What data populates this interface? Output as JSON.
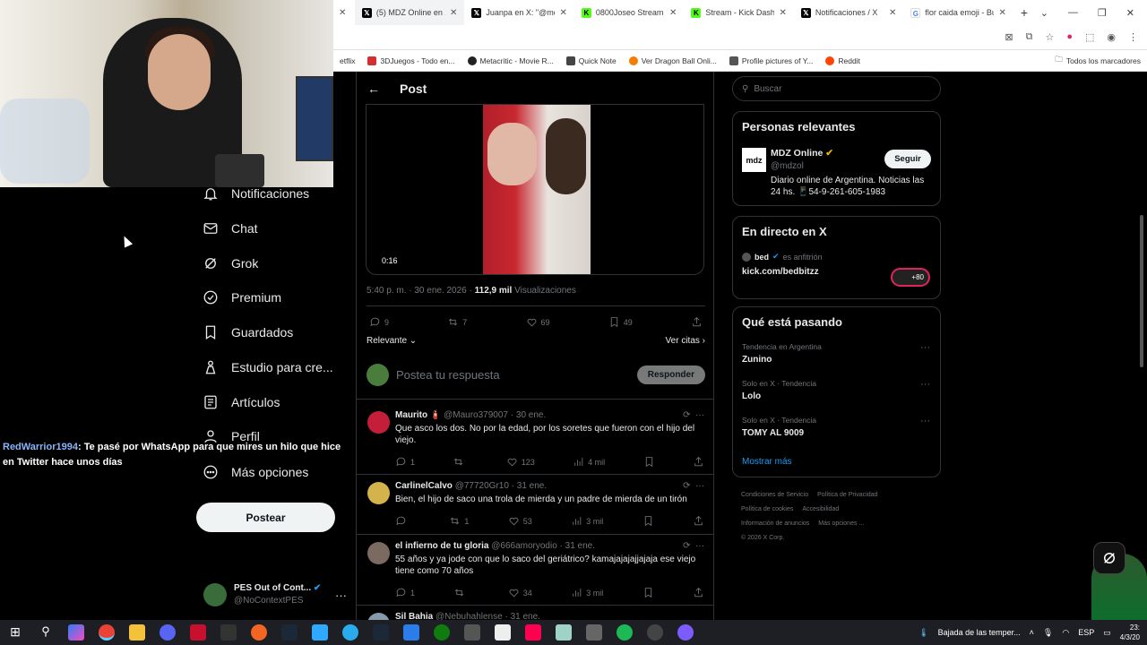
{
  "browser": {
    "tabs": [
      {
        "label": "(5) MDZ Online en X: \"",
        "icon": "x-logo-icon",
        "color": "#000000",
        "active": true
      },
      {
        "label": "Juanpa en X: \"@mdz...",
        "icon": "x-logo-icon",
        "color": "#000000"
      },
      {
        "label": "0800Joseo Stream - V...",
        "icon": "kick-logo-icon",
        "color": "#53fc18"
      },
      {
        "label": "Stream - Kick Dashbo...",
        "icon": "kick-logo-icon",
        "color": "#53fc18"
      },
      {
        "label": "Notificaciones / X",
        "icon": "x-logo-icon",
        "color": "#000000"
      },
      {
        "label": "flor caida emoji - Bus...",
        "icon": "google-logo-icon",
        "color": "#4285f4"
      }
    ],
    "bookmarks": [
      {
        "label": "etflix",
        "color": "#e50914"
      },
      {
        "label": "3DJuegos - Todo en...",
        "color": "#d32f2f"
      },
      {
        "label": "Metacritic - Movie R...",
        "color": "#222222"
      },
      {
        "label": "Quick Note",
        "color": "#444444"
      },
      {
        "label": "Ver Dragon Ball Onli...",
        "color": "#f57c00"
      },
      {
        "label": "Profile pictures of Y...",
        "color": "#555555"
      },
      {
        "label": "Reddit",
        "color": "#ff4500"
      }
    ],
    "all_bookmarks": "Todos los marcadores"
  },
  "nav": {
    "items": [
      {
        "label": "Notificaciones",
        "icon": "bell-icon"
      },
      {
        "label": "Chat",
        "icon": "mail-icon"
      },
      {
        "label": "Grok",
        "icon": "grok-icon"
      },
      {
        "label": "Premium",
        "icon": "verified-icon"
      },
      {
        "label": "Guardados",
        "icon": "bookmark-icon"
      },
      {
        "label": "Estudio para cre...",
        "icon": "creator-studio-icon"
      },
      {
        "label": "Artículos",
        "icon": "article-icon"
      },
      {
        "label": "Perfil",
        "icon": "person-icon"
      },
      {
        "label": "Más opciones",
        "icon": "more-circle-icon"
      }
    ],
    "post_button": "Postear",
    "account": {
      "name": "PES Out of Cont...",
      "handle": "@NoContextPES"
    }
  },
  "chat_overlay": {
    "user": "RedWarrior1994",
    "message": ": Te pasé por WhatsApp para que mires un hilo que hice en Twitter hace unos días"
  },
  "post": {
    "header": "Post",
    "video_time": "0:16",
    "timestamp": "5:40 p. m. · 30 ene. 2026 · ",
    "views_count": "112,9 mil",
    "views_label": " Visualizaciones",
    "stats": {
      "replies": "9",
      "reposts": "7",
      "likes": "69",
      "bookmarks": "49"
    },
    "sort_label": "Relevante",
    "quotes_label": "Ver citas",
    "reply_placeholder": "Postea tu respuesta",
    "reply_button": "Responder"
  },
  "replies": [
    {
      "name": "Maurito 🧯",
      "handle": "@Mauro379007 · 30 ene.",
      "text": "Que asco los dos. No por la edad, por los soretes que fueron con el hijo del viejo.",
      "replies": "1",
      "reposts": "",
      "likes": "123",
      "views": "4 mil",
      "avatar_color": "#c41e3a"
    },
    {
      "name": "CarlinelCalvo",
      "handle": "@77720Gr10 · 31 ene.",
      "text": "Bien, el hijo de saco una trola de mierda y un padre de mierda de un tirón",
      "replies": "",
      "reposts": "1",
      "likes": "53",
      "views": "3 mil",
      "avatar_color": "#d4b24c"
    },
    {
      "name": "el infierno de tu gloria",
      "handle": "@666amoryodio · 31 ene.",
      "text": "55 años y ya jode con que lo saco del geriátrico? kamajajajajjajaja ese viejo tiene como 70 años",
      "replies": "1",
      "reposts": "",
      "likes": "34",
      "views": "3 mil",
      "avatar_color": "#7a6a60"
    },
    {
      "name": "Sil Bahia",
      "handle": "@Nebuhahlense · 31 ene.",
      "text": "",
      "avatar_color": "#8899aa"
    }
  ],
  "sidebar": {
    "search_placeholder": "Buscar",
    "relevant": {
      "title": "Personas relevantes",
      "name": "MDZ Online",
      "handle": "@mdzol",
      "bio": "Diario online de Argentina. Noticias las 24 hs. 📱54-9-261-605-1983",
      "follow": "Seguir",
      "logo_text": "mdz"
    },
    "live": {
      "title": "En directo en X",
      "host": "bed",
      "host_suffix": "es anfitrión",
      "link": "kick.com/bedbitzz",
      "viewers": "+80"
    },
    "trends": {
      "title": "Qué está pasando",
      "items": [
        {
          "context": "Tendencia en Argentina",
          "name": "Zunino"
        },
        {
          "context": "Solo en X · Tendencia",
          "name": "Lolo"
        },
        {
          "context": "Solo en X · Tendencia",
          "name": "TOMY AL 9009"
        }
      ],
      "show_more": "Mostrar más"
    },
    "footer": [
      "Condiciones de Servicio",
      "Política de Privacidad",
      "Política de cookies",
      "Accesibilidad",
      "Información de anuncios",
      "Más opciones ...",
      "© 2026 X Corp."
    ]
  },
  "taskbar": {
    "weather": "Bajada de las temper...",
    "lang": "ESP",
    "time": "23:",
    "date": "4/3/20"
  }
}
